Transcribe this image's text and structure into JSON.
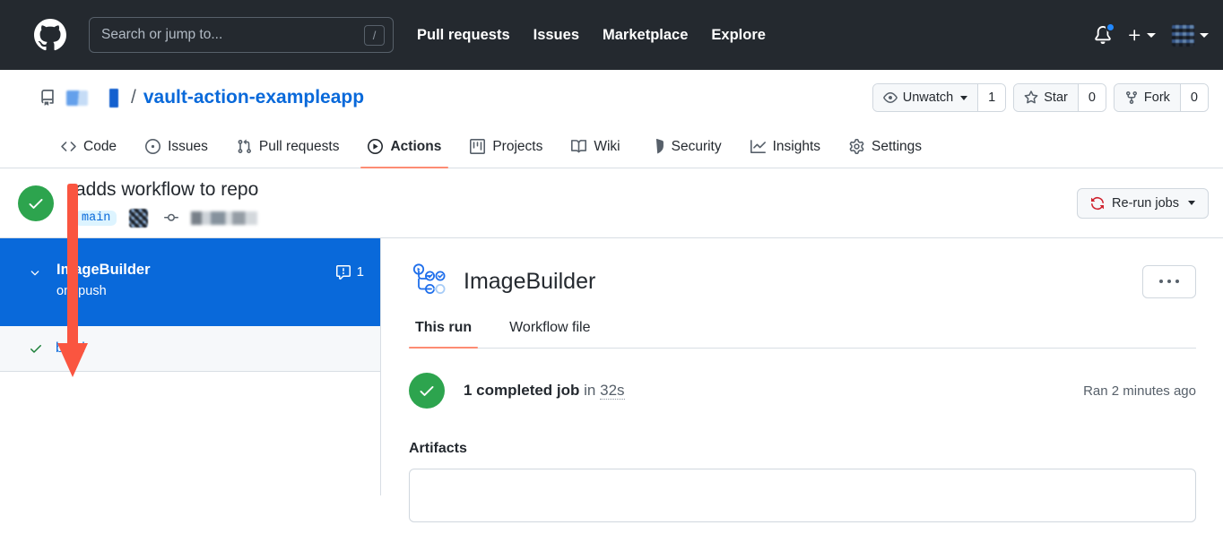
{
  "colors": {
    "header_bg": "#24292f",
    "link_blue": "#0969da",
    "success_green": "#2da44e",
    "selected_blue": "#0969da",
    "tab_underline": "#fd8c73",
    "rerun_icon_red": "#cf222e",
    "annotation_arrow": "#fa5540"
  },
  "header": {
    "logo_icon": "github-octocat-icon",
    "search": {
      "placeholder": "Search or jump to...",
      "shortcut_badge": "/"
    },
    "nav": [
      {
        "label": "Pull requests"
      },
      {
        "label": "Issues"
      },
      {
        "label": "Marketplace"
      },
      {
        "label": "Explore"
      }
    ],
    "notifications_icon": "bell-icon",
    "has_unread_notifications": true,
    "create_new_icon": "plus-icon",
    "avatar_icon": "user-avatar-redacted"
  },
  "repo": {
    "repo_icon": "repository-icon",
    "owner_redacted": true,
    "separator": "/",
    "name": "vault-action-exampleapp",
    "actions": [
      {
        "icon": "eye-icon",
        "label": "Unwatch",
        "count": "1",
        "has_caret": true
      },
      {
        "icon": "star-icon",
        "label": "Star",
        "count": "0",
        "has_caret": false
      },
      {
        "icon": "fork-icon",
        "label": "Fork",
        "count": "0",
        "has_caret": false
      }
    ]
  },
  "repo_tabs": [
    {
      "label": "Code",
      "icon": "code-icon",
      "active": false
    },
    {
      "label": "Issues",
      "icon": "issue-opened-icon",
      "active": false
    },
    {
      "label": "Pull requests",
      "icon": "git-pull-request-icon",
      "active": false
    },
    {
      "label": "Actions",
      "icon": "play-icon",
      "active": true
    },
    {
      "label": "Projects",
      "icon": "project-icon",
      "active": false
    },
    {
      "label": "Wiki",
      "icon": "book-icon",
      "active": false
    },
    {
      "label": "Security",
      "icon": "shield-icon",
      "active": false
    },
    {
      "label": "Insights",
      "icon": "graph-icon",
      "active": false
    },
    {
      "label": "Settings",
      "icon": "gear-icon",
      "active": false
    }
  ],
  "run_header": {
    "status_icon": "check-circle-icon",
    "status": "success",
    "title": "adds workflow to repo",
    "branch": "main",
    "author_avatar": "user-avatar-redacted",
    "commit_icon": "git-commit-icon",
    "commit_sha_redacted": true,
    "rerun_button": {
      "icon": "sync-icon",
      "label": "Re-run jobs",
      "has_caret": true
    }
  },
  "sidebar": {
    "job_group": {
      "chevron_icon": "chevron-down-icon",
      "name": "ImageBuilder",
      "trigger": "on: push",
      "annotation_icon": "report-warning-icon",
      "annotation_count": "1",
      "selected": true
    },
    "jobs": [
      {
        "status_icon": "check-icon",
        "label": "build",
        "status": "success"
      }
    ]
  },
  "main": {
    "workflow_icon": "workflow-graph-icon",
    "workflow_name": "ImageBuilder",
    "overflow_menu_icon": "kebab-horizontal-icon",
    "tabs": [
      {
        "label": "This run",
        "active": true
      },
      {
        "label": "Workflow file",
        "active": false
      }
    ],
    "summary": {
      "status_icon": "check-circle-icon",
      "jobs_text": "1 completed job",
      "in_word": "in",
      "duration": "32s",
      "ran_ago": "Ran 2 minutes ago"
    },
    "artifacts": {
      "heading": "Artifacts"
    }
  },
  "annotation": {
    "arrow_icon": "red-down-arrow-annotation",
    "points_to": "build"
  }
}
